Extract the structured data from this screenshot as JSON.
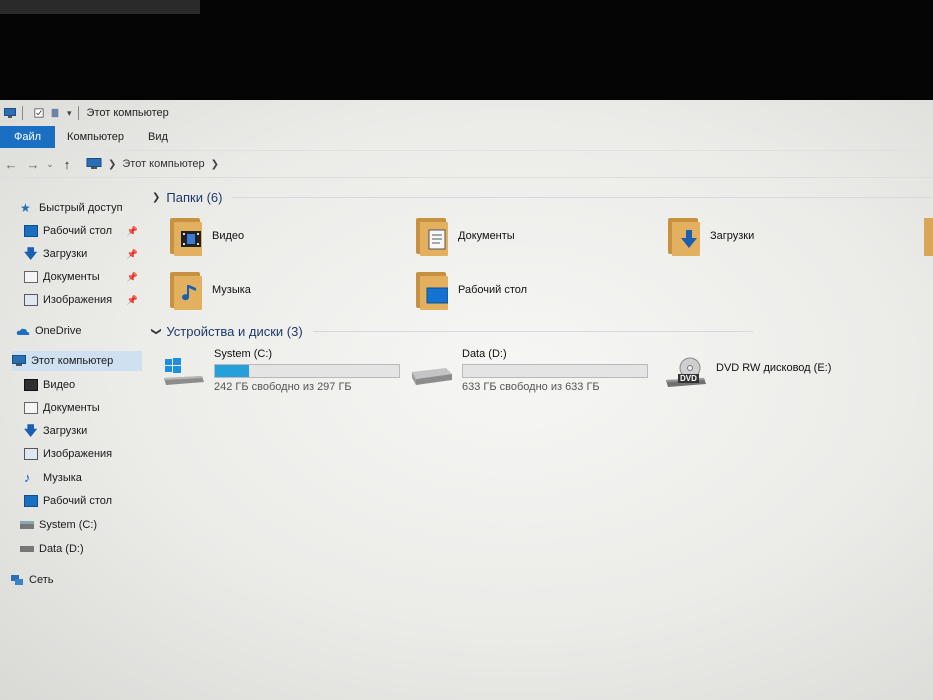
{
  "window": {
    "title": "Этот компьютер"
  },
  "ribbon": {
    "tabs": [
      "Файл",
      "Компьютер",
      "Вид"
    ]
  },
  "address": {
    "path": "Этот компьютер"
  },
  "sidebar": {
    "quick_access": "Быстрый доступ",
    "quick_items": [
      "Рабочий стол",
      "Загрузки",
      "Документы",
      "Изображения"
    ],
    "onedrive": "OneDrive",
    "this_pc": "Этот компьютер",
    "pc_items": [
      "Видео",
      "Документы",
      "Загрузки",
      "Изображения",
      "Музыка",
      "Рабочий стол",
      "System (C:)",
      "Data (D:)"
    ],
    "network": "Сеть"
  },
  "folders": {
    "header": "Папки (6)",
    "items": [
      "Видео",
      "Документы",
      "Загрузки",
      "Музыка",
      "Рабочий стол"
    ]
  },
  "devices": {
    "header": "Устройства и диски (3)",
    "drives": [
      {
        "name": "System (C:)",
        "free": "242 ГБ свободно из 297 ГБ",
        "used_fraction": 0.185
      },
      {
        "name": "Data (D:)",
        "free": "633 ГБ свободно из 633 ГБ",
        "used_fraction": 0.0
      },
      {
        "name": "DVD RW дисковод (E:)",
        "badge": "DVD"
      }
    ]
  },
  "colors": {
    "accent": "#1b6fc2",
    "progress": "#26a0da",
    "folder": "#e3b060"
  }
}
